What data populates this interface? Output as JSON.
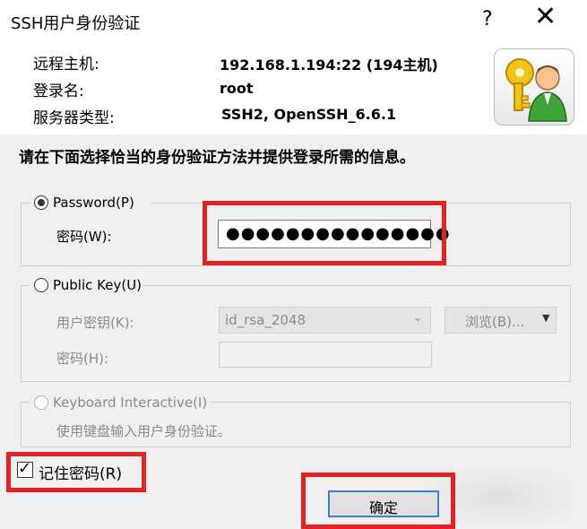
{
  "window": {
    "title": "SSH用户身份验证",
    "help_label": "?",
    "close_label": "✕"
  },
  "info": {
    "host_label": "远程主机:",
    "host_value": "192.168.1.194:22 (194主机)",
    "login_label": "登录名:",
    "login_value": "root",
    "server_type_label": "服务器类型:",
    "server_type_value": "SSH2, OpenSSH_6.6.1"
  },
  "instruction": "请在下面选择恰当的身份验证方法并提供登录所需的信息。",
  "password_method": {
    "label": "Password(P)",
    "selected": true,
    "field_label": "密码(W):",
    "field_value": "●●●●●●●●●●●●●●●"
  },
  "public_key_method": {
    "label": "Public Key(U)",
    "selected": false,
    "user_key_label": "用户密钥(K):",
    "user_key_value": "id_rsa_2048",
    "browse_label": "浏览(B)...",
    "passphrase_label": "密码(H):"
  },
  "keyboard_method": {
    "label": "Keyboard Interactive(I)",
    "selected": false,
    "description": "使用键盘输入用户身份验证。"
  },
  "remember_password": {
    "label": "记住密码(R)",
    "checked": true,
    "check_glyph": "✓"
  },
  "ok_button": "确定",
  "icons": {
    "dropdown": "chevron-down-icon",
    "browse_menu": "triangle-down-icon",
    "user": "user-key-icon"
  },
  "colors": {
    "highlight": "#e32323",
    "focus_border": "#3c7fd4",
    "dialog_background": "#f0f0f0"
  }
}
